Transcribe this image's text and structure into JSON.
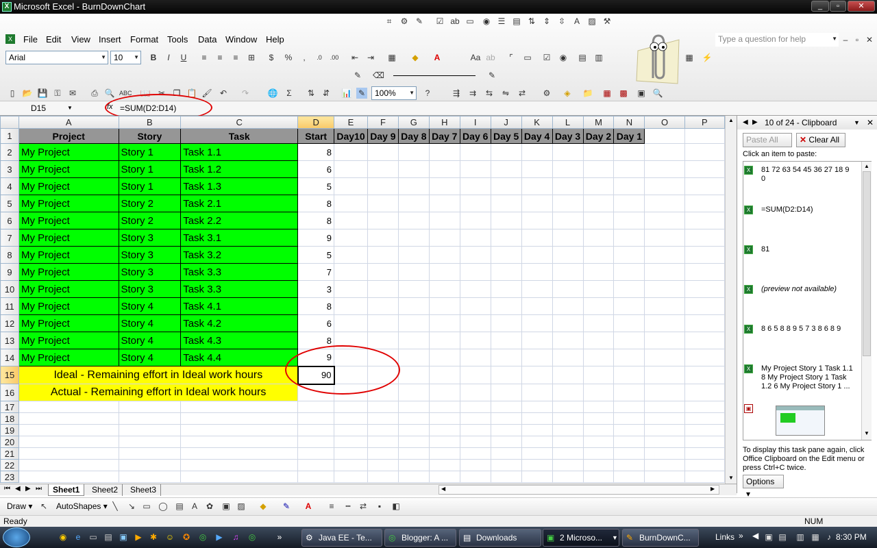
{
  "window": {
    "title": "Microsoft Excel - BurnDownChart"
  },
  "menu": [
    "File",
    "Edit",
    "View",
    "Insert",
    "Format",
    "Tools",
    "Data",
    "Window",
    "Help"
  ],
  "help_box": {
    "placeholder": "Type a question for help"
  },
  "format_toolbar": {
    "font": "Arial",
    "size": "10"
  },
  "standard_toolbar": {
    "zoom": "100%"
  },
  "formula_bar": {
    "name_box": "D15",
    "fx": "fx",
    "formula": "=SUM(D2:D14)"
  },
  "columns": [
    "A",
    "B",
    "C",
    "D",
    "E",
    "F",
    "G",
    "H",
    "I",
    "J",
    "K",
    "L",
    "M",
    "N",
    "O",
    "P"
  ],
  "header_row": [
    "Project",
    "Story",
    "Task",
    "Start",
    "Day10",
    "Day 9",
    "Day 8",
    "Day 7",
    "Day 6",
    "Day 5",
    "Day 4",
    "Day 3",
    "Day 2",
    "Day 1"
  ],
  "rows": [
    {
      "n": "2",
      "project": "My Project",
      "story": "Story 1",
      "task": "Task 1.1",
      "start": "8"
    },
    {
      "n": "3",
      "project": "My Project",
      "story": "Story 1",
      "task": "Task 1.2",
      "start": "6"
    },
    {
      "n": "4",
      "project": "My Project",
      "story": "Story 1",
      "task": "Task 1.3",
      "start": "5"
    },
    {
      "n": "5",
      "project": "My Project",
      "story": "Story 2",
      "task": "Task 2.1",
      "start": "8"
    },
    {
      "n": "6",
      "project": "My Project",
      "story": "Story 2",
      "task": "Task 2.2",
      "start": "8"
    },
    {
      "n": "7",
      "project": "My Project",
      "story": "Story 3",
      "task": "Task 3.1",
      "start": "9"
    },
    {
      "n": "8",
      "project": "My Project",
      "story": "Story 3",
      "task": "Task 3.2",
      "start": "5"
    },
    {
      "n": "9",
      "project": "My Project",
      "story": "Story 3",
      "task": "Task 3.3",
      "start": "7"
    },
    {
      "n": "10",
      "project": "My Project",
      "story": "Story 3",
      "task": "Task 3.3",
      "start": "3"
    },
    {
      "n": "11",
      "project": "My Project",
      "story": "Story 4",
      "task": "Task 4.1",
      "start": "8"
    },
    {
      "n": "12",
      "project": "My Project",
      "story": "Story 4",
      "task": "Task 4.2",
      "start": "6"
    },
    {
      "n": "13",
      "project": "My Project",
      "story": "Story 4",
      "task": "Task 4.3",
      "start": "8"
    },
    {
      "n": "14",
      "project": "My Project",
      "story": "Story 4",
      "task": "Task 4.4",
      "start": "9"
    }
  ],
  "ideal_row": {
    "n": "15",
    "label": "Ideal - Remaining effort in Ideal work hours",
    "value": "90"
  },
  "actual_row": {
    "n": "16",
    "label": "Actual - Remaining effort in Ideal work hours"
  },
  "empty_rows": [
    "17",
    "18",
    "19",
    "20",
    "21",
    "22",
    "23"
  ],
  "sheet_tabs": [
    "Sheet1",
    "Sheet2",
    "Sheet3"
  ],
  "drawing_toolbar": {
    "draw": "Draw",
    "autoshapes": "AutoShapes"
  },
  "status": {
    "left": "Ready",
    "num": "NUM"
  },
  "clipboard": {
    "title": "10 of 24 - Clipboard",
    "paste_all": "Paste All",
    "clear_all": "Clear All",
    "instruction": "Click an item to paste:",
    "items": [
      "81 72 63 54 45 36 27 18 9 0",
      "=SUM(D2:D14)",
      "81",
      "(preview not available)",
      "8 6 5 8 8 9 5 7 3 8 6 8 9",
      "My Project Story 1 Task 1.1 8 My Project Story 1 Task 1.2 6 My Project Story 1 ..."
    ],
    "footer": "To display this task pane again, click Office Clipboard on the Edit menu or press Ctrl+C twice.",
    "options": "Options"
  },
  "taskbar": {
    "buttons": [
      "Java EE - Te...",
      "Blogger: A ...",
      "Downloads",
      "2 Microso...",
      "BurnDownC..."
    ],
    "links": "Links",
    "time": "8:30 PM"
  },
  "colors": {
    "header_gray": "#969696",
    "task_green": "#00ff00",
    "summary_yellow": "#ffff00",
    "annotation_red": "#e00000"
  }
}
